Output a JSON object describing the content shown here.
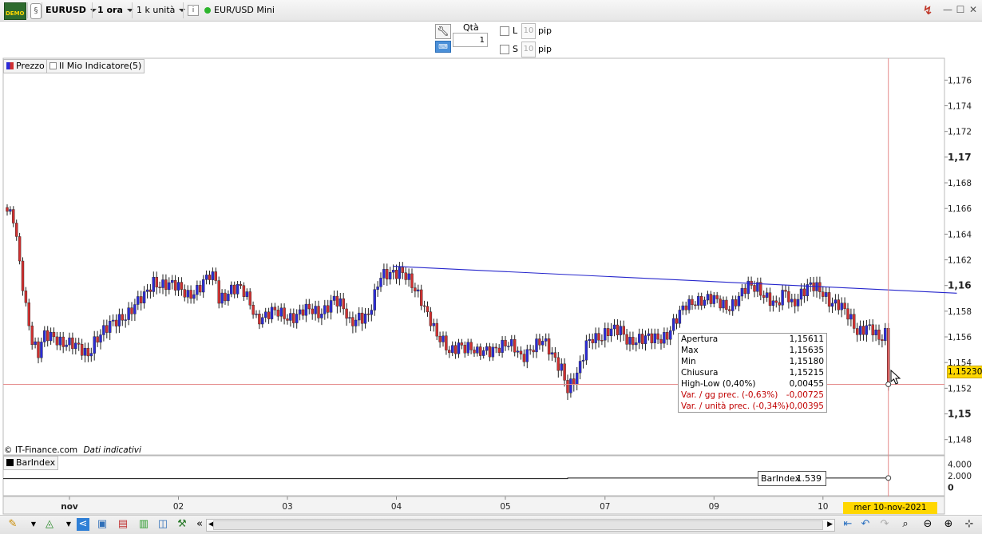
{
  "toolbar": {
    "demo_badge": "DEMO",
    "symbol": "EURUSD",
    "timeframe": "1 ora",
    "units": "1 k unità",
    "info_icon": "i",
    "instrument_status": "EUR/USD Mini",
    "status_color": "#2db52d"
  },
  "order_panel": {
    "qty_label": "Qtà",
    "qty_value": "1",
    "long_label": "L",
    "short_label": "S",
    "long_pips": "10",
    "short_pips": "10",
    "pip_unit": "pip"
  },
  "legend": {
    "price_label": "Prezzo",
    "indicator_label": "Il Mio Indicatore(5)",
    "price_color": "#cc2222",
    "barindex_label": "BarIndex"
  },
  "footer_note": {
    "source": "© IT-Finance.com",
    "disclaimer": "Dati indicativi"
  },
  "tooltip": {
    "rows": [
      {
        "label": "Apertura",
        "value": "1,15611"
      },
      {
        "label": "Max",
        "value": "1,15635"
      },
      {
        "label": "Min",
        "value": "1,15180"
      },
      {
        "label": "Chiusura",
        "value": "1,15215"
      },
      {
        "label": "High-Low (0,40%)",
        "value": "0,00455"
      },
      {
        "label": "Var. / gg prec. (-0,63%)",
        "value": "-0,00725"
      },
      {
        "label": "Var. / unità prec. (-0,34%)",
        "value": "-0,00395"
      }
    ]
  },
  "barindex_readout": {
    "label": "BarIndex",
    "value": "1.539"
  },
  "crosshair": {
    "price_label": "1,15230",
    "date_label": "mer 10-nov-2021 16:00"
  },
  "chart_data": [
    {
      "type": "candlestick",
      "title": "",
      "y_axis_ticks": [
        "1,176",
        "1,174",
        "1,172",
        "1,17",
        "1,168",
        "1,166",
        "1,164",
        "1,162",
        "1,16",
        "1,158",
        "1,156",
        "1,154",
        "1,152",
        "1,15",
        "1,148"
      ],
      "ylim": [
        1.1468,
        1.1777
      ],
      "x_tick_labels": [
        "nov",
        "02",
        "03",
        "04",
        "05",
        "07",
        "09",
        "10"
      ],
      "x_tick_index": [
        20,
        55,
        90,
        125,
        160,
        192,
        227,
        262
      ],
      "bullish_color": "#2b2bd8",
      "bearish_color": "#d03030",
      "trendline": {
        "color": "#2626cc",
        "from": {
          "bar": 124,
          "price": 1.1615
        },
        "to": {
          "bar": 305,
          "price": 1.1594
        }
      },
      "crosshair_price": 1.1523,
      "keyframes": [
        [
          0,
          1.1655
        ],
        [
          2,
          1.1652
        ],
        [
          4,
          1.162
        ],
        [
          6,
          1.1585
        ],
        [
          7,
          1.1572
        ],
        [
          8,
          1.1556
        ],
        [
          10,
          1.1545
        ],
        [
          12,
          1.156
        ],
        [
          15,
          1.1562
        ],
        [
          18,
          1.1556
        ],
        [
          22,
          1.1551
        ],
        [
          26,
          1.1548
        ],
        [
          28,
          1.1558
        ],
        [
          32,
          1.1565
        ],
        [
          36,
          1.1575
        ],
        [
          40,
          1.1582
        ],
        [
          44,
          1.159
        ],
        [
          47,
          1.1604
        ],
        [
          50,
          1.1602
        ],
        [
          54,
          1.1598
        ],
        [
          58,
          1.1594
        ],
        [
          62,
          1.1599
        ],
        [
          65,
          1.1606
        ],
        [
          67,
          1.1604
        ],
        [
          68,
          1.159
        ],
        [
          72,
          1.1598
        ],
        [
          75,
          1.1596
        ],
        [
          78,
          1.1586
        ],
        [
          80,
          1.1576
        ],
        [
          85,
          1.1578
        ],
        [
          90,
          1.1576
        ],
        [
          95,
          1.158
        ],
        [
          100,
          1.1578
        ],
        [
          103,
          1.1586
        ],
        [
          105,
          1.159
        ],
        [
          108,
          1.158
        ],
        [
          110,
          1.157
        ],
        [
          113,
          1.1578
        ],
        [
          116,
          1.1576
        ],
        [
          118,
          1.159
        ],
        [
          120,
          1.1606
        ],
        [
          123,
          1.1612
        ],
        [
          126,
          1.1612
        ],
        [
          128,
          1.1606
        ],
        [
          130,
          1.1598
        ],
        [
          133,
          1.159
        ],
        [
          136,
          1.1575
        ],
        [
          138,
          1.156
        ],
        [
          142,
          1.1547
        ],
        [
          145,
          1.1556
        ],
        [
          148,
          1.1552
        ],
        [
          151,
          1.1545
        ],
        [
          154,
          1.155
        ],
        [
          157,
          1.1553
        ],
        [
          160,
          1.1553
        ],
        [
          163,
          1.155
        ],
        [
          165,
          1.1545
        ],
        [
          168,
          1.1552
        ],
        [
          172,
          1.1555
        ],
        [
          175,
          1.1546
        ],
        [
          178,
          1.1538
        ],
        [
          180,
          1.152
        ],
        [
          182,
          1.1524
        ],
        [
          184,
          1.1535
        ],
        [
          186,
          1.1555
        ],
        [
          188,
          1.1562
        ],
        [
          191,
          1.156
        ],
        [
          194,
          1.1563
        ],
        [
          197,
          1.1566
        ],
        [
          200,
          1.1558
        ],
        [
          204,
          1.1556
        ],
        [
          208,
          1.156
        ],
        [
          212,
          1.1562
        ],
        [
          215,
          1.1572
        ],
        [
          218,
          1.1585
        ],
        [
          221,
          1.159
        ],
        [
          224,
          1.1588
        ],
        [
          228,
          1.1587
        ],
        [
          232,
          1.1585
        ],
        [
          235,
          1.159
        ],
        [
          238,
          1.1598
        ],
        [
          241,
          1.16
        ],
        [
          244,
          1.1592
        ],
        [
          247,
          1.1582
        ],
        [
          250,
          1.1595
        ],
        [
          252,
          1.1587
        ],
        [
          255,
          1.1595
        ],
        [
          258,
          1.1598
        ],
        [
          262,
          1.1595
        ],
        [
          264,
          1.159
        ],
        [
          267,
          1.1585
        ],
        [
          270,
          1.1575
        ],
        [
          273,
          1.1565
        ],
        [
          276,
          1.157
        ],
        [
          278,
          1.1565
        ],
        [
          280,
          1.1555
        ],
        [
          282,
          1.1561
        ],
        [
          283,
          1.1523
        ]
      ]
    },
    {
      "type": "line",
      "title": "BarIndex",
      "y_axis_ticks": [
        "4.000",
        "2.000",
        "0"
      ],
      "ylim": [
        -0.0015,
        0.0055
      ],
      "values": [
        0.0015,
        0.0016
      ]
    }
  ],
  "bottom_toolbar": {
    "icons": [
      "pencil-icon",
      "chart-type-icon",
      "share-icon",
      "chat-icon",
      "list-icon",
      "columns-icon",
      "windows-icon",
      "tools-icon",
      "scroll-left-icon",
      "undo-icon",
      "redo-icon",
      "zoom-select-icon",
      "zoom-out-icon",
      "zoom-in-icon",
      "crosshair-icon"
    ]
  }
}
